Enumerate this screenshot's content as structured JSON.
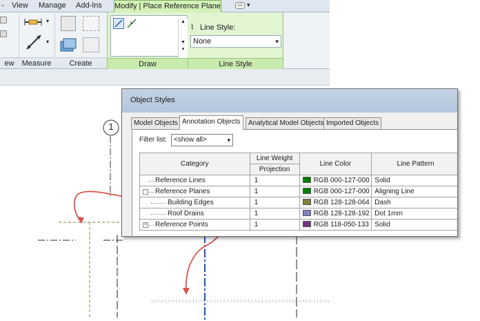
{
  "ribbon": {
    "tabs": [
      "View",
      "Manage",
      "Add-Ins"
    ],
    "context_tab": "Modify | Place Reference Plane",
    "panels": [
      "ew",
      "Measure",
      "Create",
      "Draw",
      "Line Style"
    ],
    "line_style_label": "Line Style:",
    "line_style_value": "None"
  },
  "canvas": {
    "grid_bubble": "1"
  },
  "dialog": {
    "title": "Object Styles",
    "tabs": [
      "Model Objects",
      "Annotation Objects",
      "Analytical Model Objects",
      "Imported Objects"
    ],
    "active_tab": 1,
    "filter_label": "Filter list:",
    "filter_value": "<show all>",
    "columns": {
      "category": "Category",
      "line_weight": "Line Weight",
      "projection": "Projection",
      "line_color": "Line Color",
      "line_pattern": "Line Pattern"
    },
    "rows": [
      {
        "category": "Reference Lines",
        "weight": "1",
        "color_name": "RGB 000-127-000",
        "color": "#007f00",
        "pattern": "Solid",
        "expander": ""
      },
      {
        "category": "Reference Planes",
        "weight": "1",
        "color_name": "RGB 000-127-000",
        "color": "#007f00",
        "pattern": "Aligning Line",
        "expander": "-"
      },
      {
        "category": "Building Edges",
        "weight": "1",
        "color_name": "RGB 128-128-064",
        "color": "#808040",
        "pattern": "Dash",
        "expander": ""
      },
      {
        "category": "Roof Drains",
        "weight": "1",
        "color_name": "RGB 128-128-192",
        "color": "#8080c0",
        "pattern": "Dot 1mm",
        "expander": ""
      },
      {
        "category": "Reference Points",
        "weight": "1",
        "color_name": "RGB 118-050-133",
        "color": "#763285",
        "pattern": "Solid",
        "expander": "+"
      }
    ]
  },
  "colors": {
    "context_tab": "#d3f2b8",
    "annotation_arrow": "#d9534f",
    "reference_plane_blue": "#1f4fbf"
  }
}
